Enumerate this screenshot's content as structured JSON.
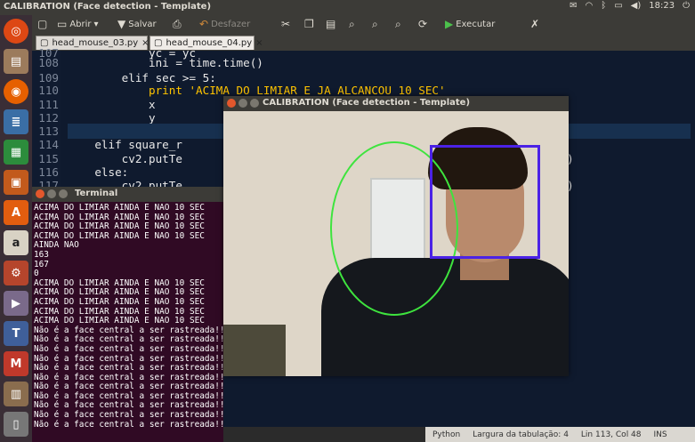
{
  "topbar": {
    "title": "CALIBRATION (Face detection - Template)",
    "clock": "18:23"
  },
  "toolbar": {
    "open_label": "Abrir",
    "save_label": "Salvar",
    "undo_label": "Desfazer",
    "run_label": "Executar"
  },
  "tabs": [
    {
      "label": "head_mouse_03.py"
    },
    {
      "label": "head_mouse_04.py"
    }
  ],
  "editor": {
    "lines": [
      {
        "n": "107",
        "code": "            yc = yc"
      },
      {
        "n": "108",
        "code": "            ini = time.time()"
      },
      {
        "n": "109",
        "code": "        elif sec >= 5:"
      },
      {
        "n": "110",
        "code": "            print 'ACIMA DO LIMIAR E JA ALCANCOU 10 SEC'"
      },
      {
        "n": "111",
        "code": "            x"
      },
      {
        "n": "112",
        "code": "            y"
      },
      {
        "n": "113",
        "code": ""
      },
      {
        "n": "114",
        "code": "    elif square_r"
      },
      {
        "n": "115",
        "code": "        cv2.putTe                                       PLEX, 2, (0,0,255))"
      },
      {
        "n": "116",
        "code": "    else:"
      },
      {
        "n": "117",
        "code": "        cv2.putTe                                       PLEX, 2, (0,0,255))"
      }
    ]
  },
  "terminal": {
    "title": "Terminal",
    "lines": [
      "ACIMA DO LIMIAR AINDA E NAO 10 SEC",
      "ACIMA DO LIMIAR AINDA E NAO 10 SEC",
      "ACIMA DO LIMIAR AINDA E NAO 10 SEC",
      "ACIMA DO LIMIAR AINDA E NAO 10 SEC",
      "AINDA NAO",
      "163",
      "167",
      "0",
      "ACIMA DO LIMIAR AINDA E NAO 10 SEC",
      "ACIMA DO LIMIAR AINDA E NAO 10 SEC",
      "ACIMA DO LIMIAR AINDA E NAO 10 SEC",
      "ACIMA DO LIMIAR AINDA E NAO 10 SEC",
      "ACIMA DO LIMIAR AINDA E NAO 10 SEC",
      "Não é a face central a ser rastreada!!",
      "Não é a face central a ser rastreada!!",
      "Não é a face central a ser rastreada!!",
      "Não é a face central a ser rastreada!!",
      "Não é a face central a ser rastreada!!",
      "Não é a face central a ser rastreada!!",
      "Não é a face central a ser rastreada!!",
      "Não é a face central a ser rastreada!!",
      "Não é a face central a ser rastreada!!",
      "Não é a face central a ser rastreada!!",
      "Não é a face central a ser rastreada!!"
    ]
  },
  "calibration": {
    "title": "CALIBRATION (Face detection - Template)"
  },
  "statusbar": {
    "language": "Python",
    "tab_width": "Largura da tabulação: 4",
    "position": "Lin 113, Col 48",
    "mode": "INS"
  },
  "colors": {
    "ellipse": "#3ee43e",
    "face_square": "#4b22e6",
    "terminal_bg": "#300a24",
    "editor_bg": "#0f1a2e"
  }
}
